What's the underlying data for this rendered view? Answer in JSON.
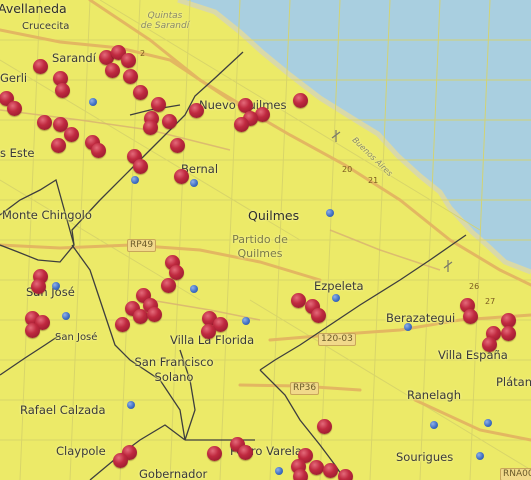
{
  "colors": {
    "water": "#a9cfe0",
    "land": "#ecea68",
    "district_border": "#3e3e3e",
    "highway": "#e3b761",
    "red_marker": "#c0334a",
    "blue_marker": "#4a7cd4"
  },
  "place_labels": {
    "avellaneda": "Avellaneda",
    "crucecita": "Crucecita",
    "sarandi": "Sarandí",
    "gerli": "Gerli",
    "nuevo_quilmes": "Nuevo Quilmes",
    "as_este": "s Este",
    "bernal": "Bernal",
    "monte_chingolo": "Monte Chingolo",
    "quilmes": "Quilmes",
    "partido_line1": "Partido de",
    "partido_line2": "Quilmes",
    "ezpeleta": "Ezpeleta",
    "san_jose_1": "San José",
    "san_jose_2": "San José",
    "villa_la_florida": "Villa La Florida",
    "san_francisco_1": "San Francisco",
    "san_francisco_2": "Solano",
    "berazategui": "Berazategui",
    "villa_espana": "Villa España",
    "platan": "Plátan",
    "rafael_calzada": "Rafael Calzada",
    "ranelagh": "Ranelagh",
    "claypole": "Claypole",
    "gobernador": "Gobernador",
    "pedro_varela": "Pedro Varela",
    "sourigues": "Sourigues",
    "quintas_1": "Quintas",
    "quintas_2": "de Sarandí",
    "buenos_aires_road": "Buenos Aires"
  },
  "road_shields": {
    "rp49": "RP49",
    "r120": "120-03",
    "rp36": "RP36",
    "rna": "RNA004"
  },
  "route_numbers": {
    "n2": "2",
    "n20": "20",
    "n21": "21",
    "n26": "26",
    "n27": "27"
  }
}
